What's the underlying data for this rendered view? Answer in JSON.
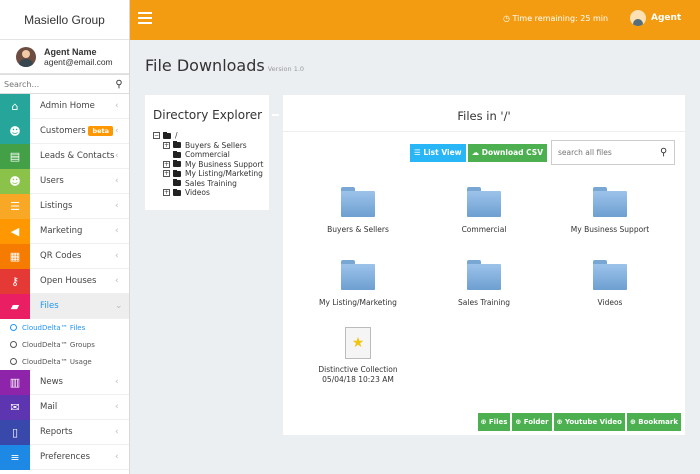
{
  "brand": "Masiello Group",
  "user": {
    "name": "Agent Name",
    "email": "agent@email.com"
  },
  "sidebar_search": {
    "placeholder": "Search..."
  },
  "nav": [
    {
      "label": "Admin Home",
      "icon": "home-icon",
      "color": "#26a69a"
    },
    {
      "label": "Customers",
      "icon": "users-icon",
      "color": "#26a69a",
      "badge": "beta"
    },
    {
      "label": "Leads & Contacts",
      "icon": "contact-card-icon",
      "color": "#43a047"
    },
    {
      "label": "Users",
      "icon": "users-icon",
      "color": "#8bc34a"
    },
    {
      "label": "Listings",
      "icon": "list-icon",
      "color": "#f9a825"
    },
    {
      "label": "Marketing",
      "icon": "megaphone-icon",
      "color": "#ff9800"
    },
    {
      "label": "QR Codes",
      "icon": "qr-icon",
      "color": "#f57c00"
    },
    {
      "label": "Open Houses",
      "icon": "key-icon",
      "color": "#e53935"
    },
    {
      "label": "Files",
      "icon": "folder-open-icon",
      "color": "#e91e63"
    },
    {
      "label": "News",
      "icon": "newspaper-icon",
      "color": "#8e24aa"
    },
    {
      "label": "Mail",
      "icon": "mail-icon",
      "color": "#5e35b1"
    },
    {
      "label": "Reports",
      "icon": "document-icon",
      "color": "#3949ab"
    },
    {
      "label": "Preferences",
      "icon": "sliders-icon",
      "color": "#1e88e5"
    }
  ],
  "files_sub": [
    "CloudDelta™ Files",
    "CloudDelta™ Groups",
    "CloudDelta™ Usage"
  ],
  "topbar": {
    "timer": "Time remaining: 25 min",
    "agent": "Agent"
  },
  "page": {
    "title": "File Downloads",
    "version": "Version 1.0"
  },
  "directory": {
    "title": "Directory Explorer",
    "root": "/",
    "items": [
      {
        "label": "Buyers & Sellers",
        "expandable": true
      },
      {
        "label": "Commercial",
        "expandable": false
      },
      {
        "label": "My Business Support",
        "expandable": true
      },
      {
        "label": "My Listing/Marketing",
        "expandable": true
      },
      {
        "label": "Sales Training",
        "expandable": false
      },
      {
        "label": "Videos",
        "expandable": true
      }
    ]
  },
  "files": {
    "title": "Files in '/'",
    "list_view": "List View",
    "download_csv": "Download CSV",
    "search_placeholder": "search all files",
    "folders": [
      "Buyers & Sellers",
      "Commercial",
      "My Business Support",
      "My Listing/Marketing",
      "Sales Training",
      "Videos"
    ],
    "doc": {
      "name": "Distinctive Collection",
      "date": "05/04/18 10:23 AM"
    },
    "actions": [
      "Files",
      "Folder",
      "Youtube Video",
      "Bookmark"
    ]
  }
}
